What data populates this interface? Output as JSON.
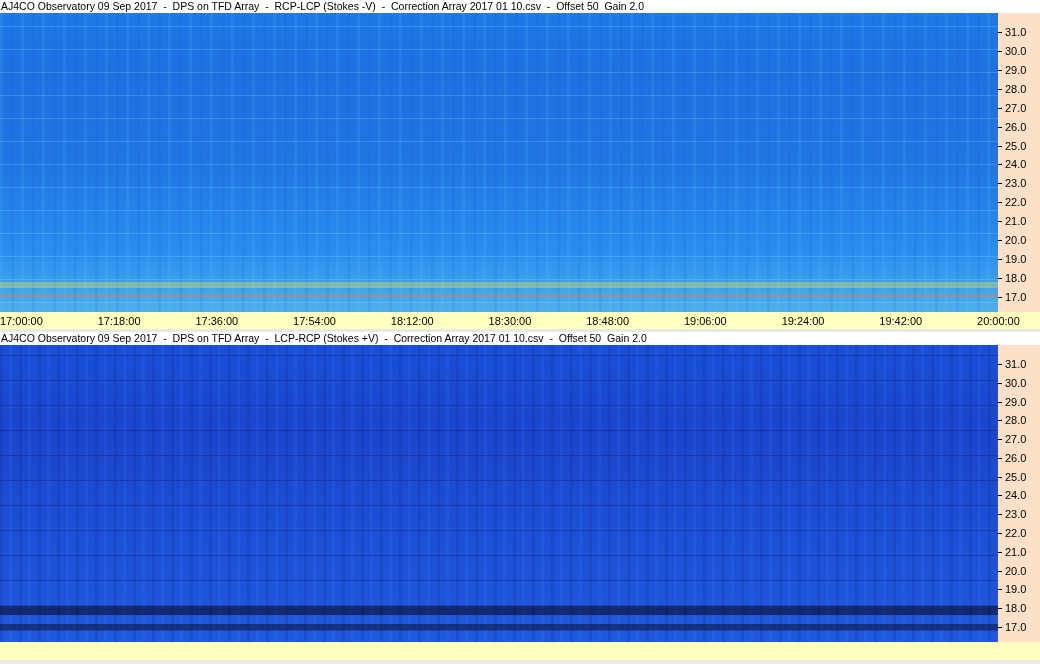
{
  "panels": [
    {
      "title": "AJ4CO Observatory 09 Sep 2017  -  DPS on TFD Array  -  RCP-LCP (Stokes -V)  -  Correction Array 2017 01 10.csv  -  Offset 50  Gain 2.0",
      "y_ticks": [
        "31.0",
        "30.0",
        "29.0",
        "28.0",
        "27.0",
        "26.0",
        "25.0",
        "24.0",
        "23.0",
        "22.0",
        "21.0",
        "20.0",
        "19.0",
        "18.0",
        "17.0"
      ],
      "x_ticks": [
        "17:00:00",
        "17:18:00",
        "17:36:00",
        "17:54:00",
        "18:12:00",
        "18:30:00",
        "18:48:00",
        "19:06:00",
        "19:24:00",
        "19:42:00",
        "20:00:00"
      ]
    },
    {
      "title": "AJ4CO Observatory 09 Sep 2017  -  DPS on TFD Array  -  LCP-RCP (Stokes +V)  -  Correction Array 2017 01 10.csv  -  Offset 50  Gain 2.0",
      "y_ticks": [
        "31.0",
        "30.0",
        "29.0",
        "28.0",
        "27.0",
        "26.0",
        "25.0",
        "24.0",
        "23.0",
        "22.0",
        "21.0",
        "20.0",
        "19.0",
        "18.0",
        "17.0"
      ]
    }
  ]
}
